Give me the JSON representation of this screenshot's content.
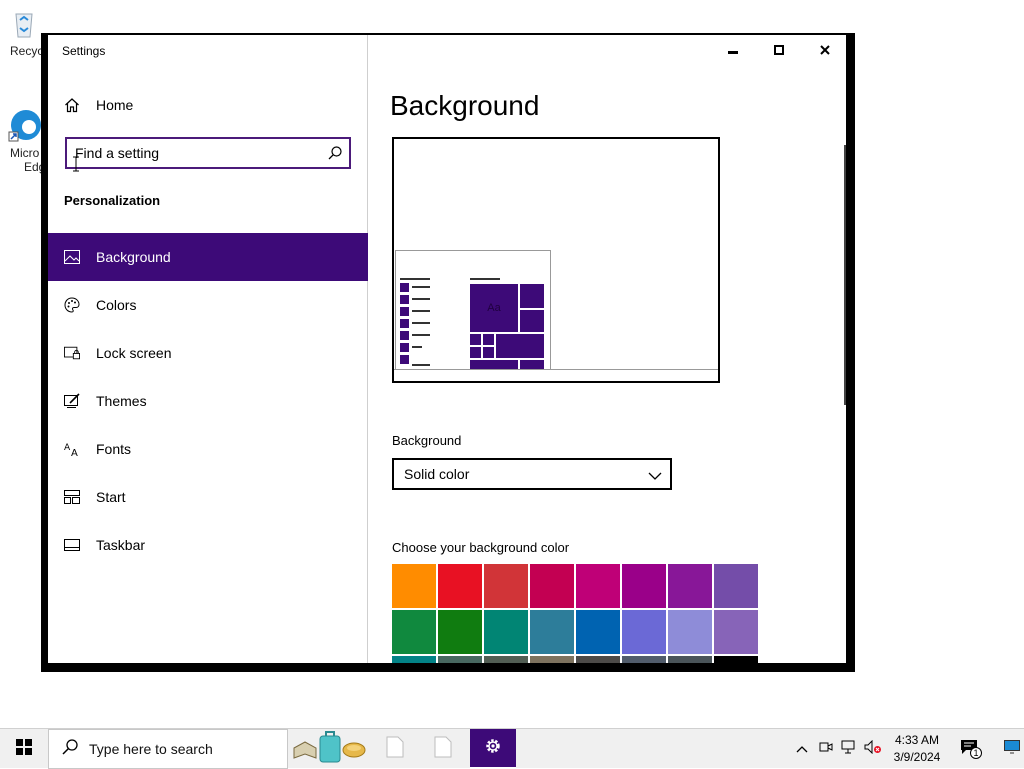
{
  "desktop": {
    "icons": [
      {
        "label": "Recycle Bin",
        "shown": "Recyc"
      },
      {
        "label_line1": "Micro",
        "label_line2": "Edg"
      }
    ]
  },
  "window": {
    "title": "Settings",
    "controls": {
      "minimize": "minimize-icon",
      "maximize": "maximize-icon",
      "close": "close-icon"
    }
  },
  "nav": {
    "home_label": "Home",
    "search_placeholder": "Find a setting",
    "section_title": "Personalization",
    "items": [
      {
        "label": "Background",
        "icon": "picture-icon",
        "active": true
      },
      {
        "label": "Colors",
        "icon": "palette-icon",
        "active": false
      },
      {
        "label": "Lock screen",
        "icon": "lock-screen-icon",
        "active": false
      },
      {
        "label": "Themes",
        "icon": "themes-icon",
        "active": false
      },
      {
        "label": "Fonts",
        "icon": "fonts-icon",
        "active": false
      },
      {
        "label": "Start",
        "icon": "start-tiles-icon",
        "active": false
      },
      {
        "label": "Taskbar",
        "icon": "taskbar-icon",
        "active": false
      }
    ]
  },
  "content": {
    "title": "Background",
    "preview_tile_text": "Aa",
    "background_label": "Background",
    "background_value": "Solid color",
    "color_label": "Choose your background color",
    "colors": [
      "#ff8c00",
      "#e81123",
      "#d13438",
      "#c30052",
      "#bf0077",
      "#9a0089",
      "#881798",
      "#744da9",
      "#10893e",
      "#107c10",
      "#018574",
      "#2d7d9a",
      "#0063b1",
      "#6b69d6",
      "#8e8cd8",
      "#8764b8",
      "#038387",
      "#486860",
      "#525e54",
      "#7e735f",
      "#4c4a48",
      "#515c6b",
      "#4a5459",
      "#000000"
    ]
  },
  "taskbar": {
    "search_placeholder": "Type here to search",
    "time": "4:33 AM",
    "date": "3/9/2024",
    "notification_count": "1",
    "accent": "#3d0a78"
  }
}
